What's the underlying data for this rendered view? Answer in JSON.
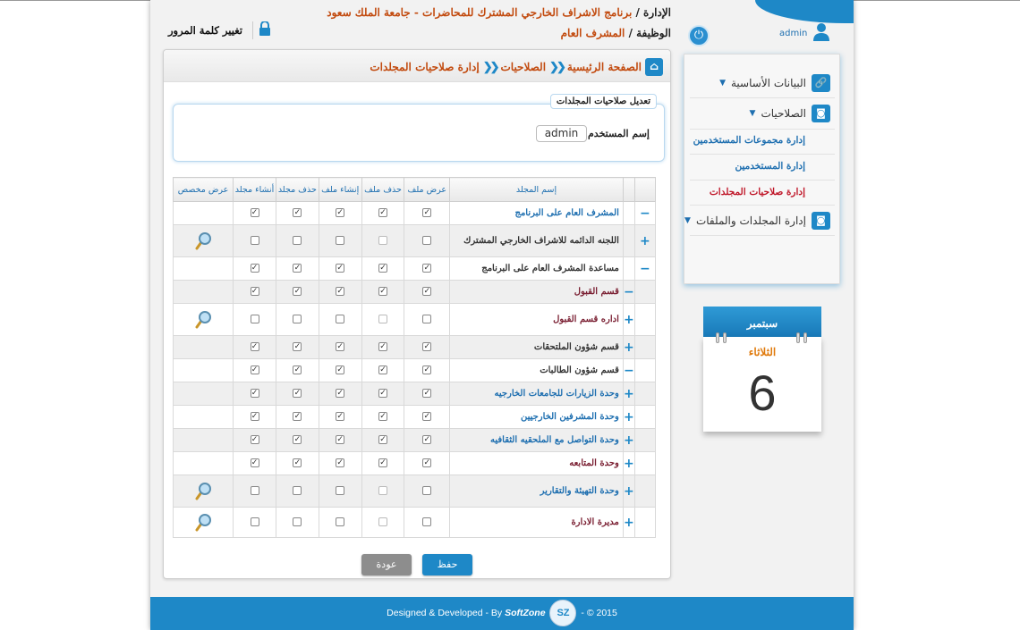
{
  "header": {
    "admin_label": "الإدارة /",
    "admin_value": "برنامج الاشراف الخارجي المشترك للمحاضرات - جامعة الملك سعود",
    "job_label": "الوظيفة /",
    "job_value": "المشرف العام",
    "username": "admin",
    "change_password": "تغيير كلمة المرور"
  },
  "breadcrumb": {
    "home": "الصفحة الرئيسية",
    "section": "الصلاحيات",
    "current": "إدارة صلاحيات المجلدات"
  },
  "form": {
    "legend": "تعديل صلاحيات المجلدات",
    "user_label": "إسم المستخدم",
    "user_value": "admin"
  },
  "table": {
    "headers": {
      "name": "إسم المجلد",
      "view": "عرض ملف",
      "delete_file": "حذف ملف",
      "create_file": "إنشاء ملف",
      "delete_folder": "حذف مجلد",
      "create_folder": "أنشاء مجلد",
      "custom": "عرض مخصص"
    },
    "rows": [
      {
        "name": "المشرف العام على البرنامج",
        "toggle": "−",
        "checked": true
      },
      {
        "name": "اللجنه الدائمه للاشراف الخارجي المشترك",
        "toggle": "+",
        "checked": false
      },
      {
        "name": "مساعدة المشرف العام على البرنامج",
        "toggle": "−",
        "checked": true
      },
      {
        "name": "قسم القبول",
        "toggle": "−",
        "checked": true
      },
      {
        "name": "اداره قسم القبول",
        "toggle": "+",
        "checked": false
      },
      {
        "name": "قسم شؤون الملتحقات",
        "toggle": "+",
        "checked": true
      },
      {
        "name": "قسم شؤون الطالبات",
        "toggle": "−",
        "checked": true
      },
      {
        "name": "وحدة الزيارات للجامعات الخارجيه",
        "toggle": "+",
        "checked": true
      },
      {
        "name": "وحدة المشرفين الخارجيين",
        "toggle": "+",
        "checked": true
      },
      {
        "name": "وحدة التواصل مع الملحقيه الثقافيه",
        "toggle": "+",
        "checked": true
      },
      {
        "name": "وحدة المتابعه",
        "toggle": "+",
        "checked": true
      },
      {
        "name": "وحدة التهيئة والتقارير",
        "toggle": "+",
        "checked": false
      },
      {
        "name": "مديرة الادارة",
        "toggle": "+",
        "checked": false
      }
    ]
  },
  "buttons": {
    "save": "حفظ",
    "back": "عودة"
  },
  "sidebar": {
    "basic_data": "البيانات الأساسية",
    "permissions": "الصلاحيات",
    "sub_groups": "إدارة مجموعات المستخدمين",
    "sub_users": "إدارة المستخدمين",
    "sub_folders": "إدارة صلاحيات المجلدات",
    "folders_files": "إدارة المجلدات والملفات"
  },
  "calendar": {
    "month": "سبتمبر",
    "weekday": "الثلاثاء",
    "day": "6"
  },
  "footer": {
    "text_before": "Designed & Developed - By",
    "brand": "SoftZone",
    "text_after": "- © 2015"
  },
  "colors": {
    "accent": "#1e88c7",
    "header_value": "#c24a0e",
    "active_link": "#c0182a"
  }
}
